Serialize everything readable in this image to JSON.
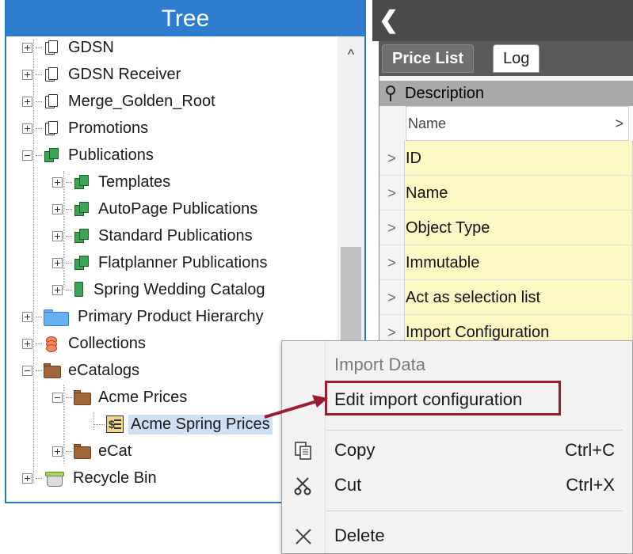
{
  "tree": {
    "title": "Tree",
    "items": [
      {
        "label": "GDSN"
      },
      {
        "label": "GDSN Receiver"
      },
      {
        "label": "Merge_Golden_Root"
      },
      {
        "label": "Promotions"
      },
      {
        "label": "Publications"
      },
      {
        "label": "Templates"
      },
      {
        "label": "AutoPage Publications"
      },
      {
        "label": "Standard Publications"
      },
      {
        "label": "Flatplanner Publications"
      },
      {
        "label": "Spring Wedding Catalog"
      },
      {
        "label": "Primary Product Hierarchy"
      },
      {
        "label": "Collections"
      },
      {
        "label": "eCatalogs"
      },
      {
        "label": "Acme Prices"
      },
      {
        "label": "Acme Spring Prices"
      },
      {
        "label": "eCat"
      },
      {
        "label": "Recycle Bin"
      }
    ],
    "scroll_up": "^"
  },
  "right_panel": {
    "collapse_glyph": "❮",
    "tabs": [
      {
        "label": "Price List"
      },
      {
        "label": "Log"
      }
    ],
    "grid_header": "Description",
    "name_filter": "Name",
    "rows": [
      {
        "label": "ID"
      },
      {
        "label": "Name"
      },
      {
        "label": "Object Type"
      },
      {
        "label": "Immutable"
      },
      {
        "label": "Act as selection list"
      },
      {
        "label": "Import Configuration"
      }
    ],
    "row_arrow": ">"
  },
  "context_menu": {
    "items": [
      {
        "label": "Import Data",
        "shortcut": ""
      },
      {
        "label": "Edit import configuration",
        "shortcut": ""
      },
      {
        "label": "Copy",
        "shortcut": "Ctrl+C"
      },
      {
        "label": "Cut",
        "shortcut": "Ctrl+X"
      },
      {
        "label": "Delete",
        "shortcut": ""
      }
    ]
  },
  "colors": {
    "tree_header": "#2e7ccd",
    "highlight_border": "#9b1c2e",
    "grid_cell": "#fdf7c4",
    "selected_item": "#cfe0f5"
  }
}
